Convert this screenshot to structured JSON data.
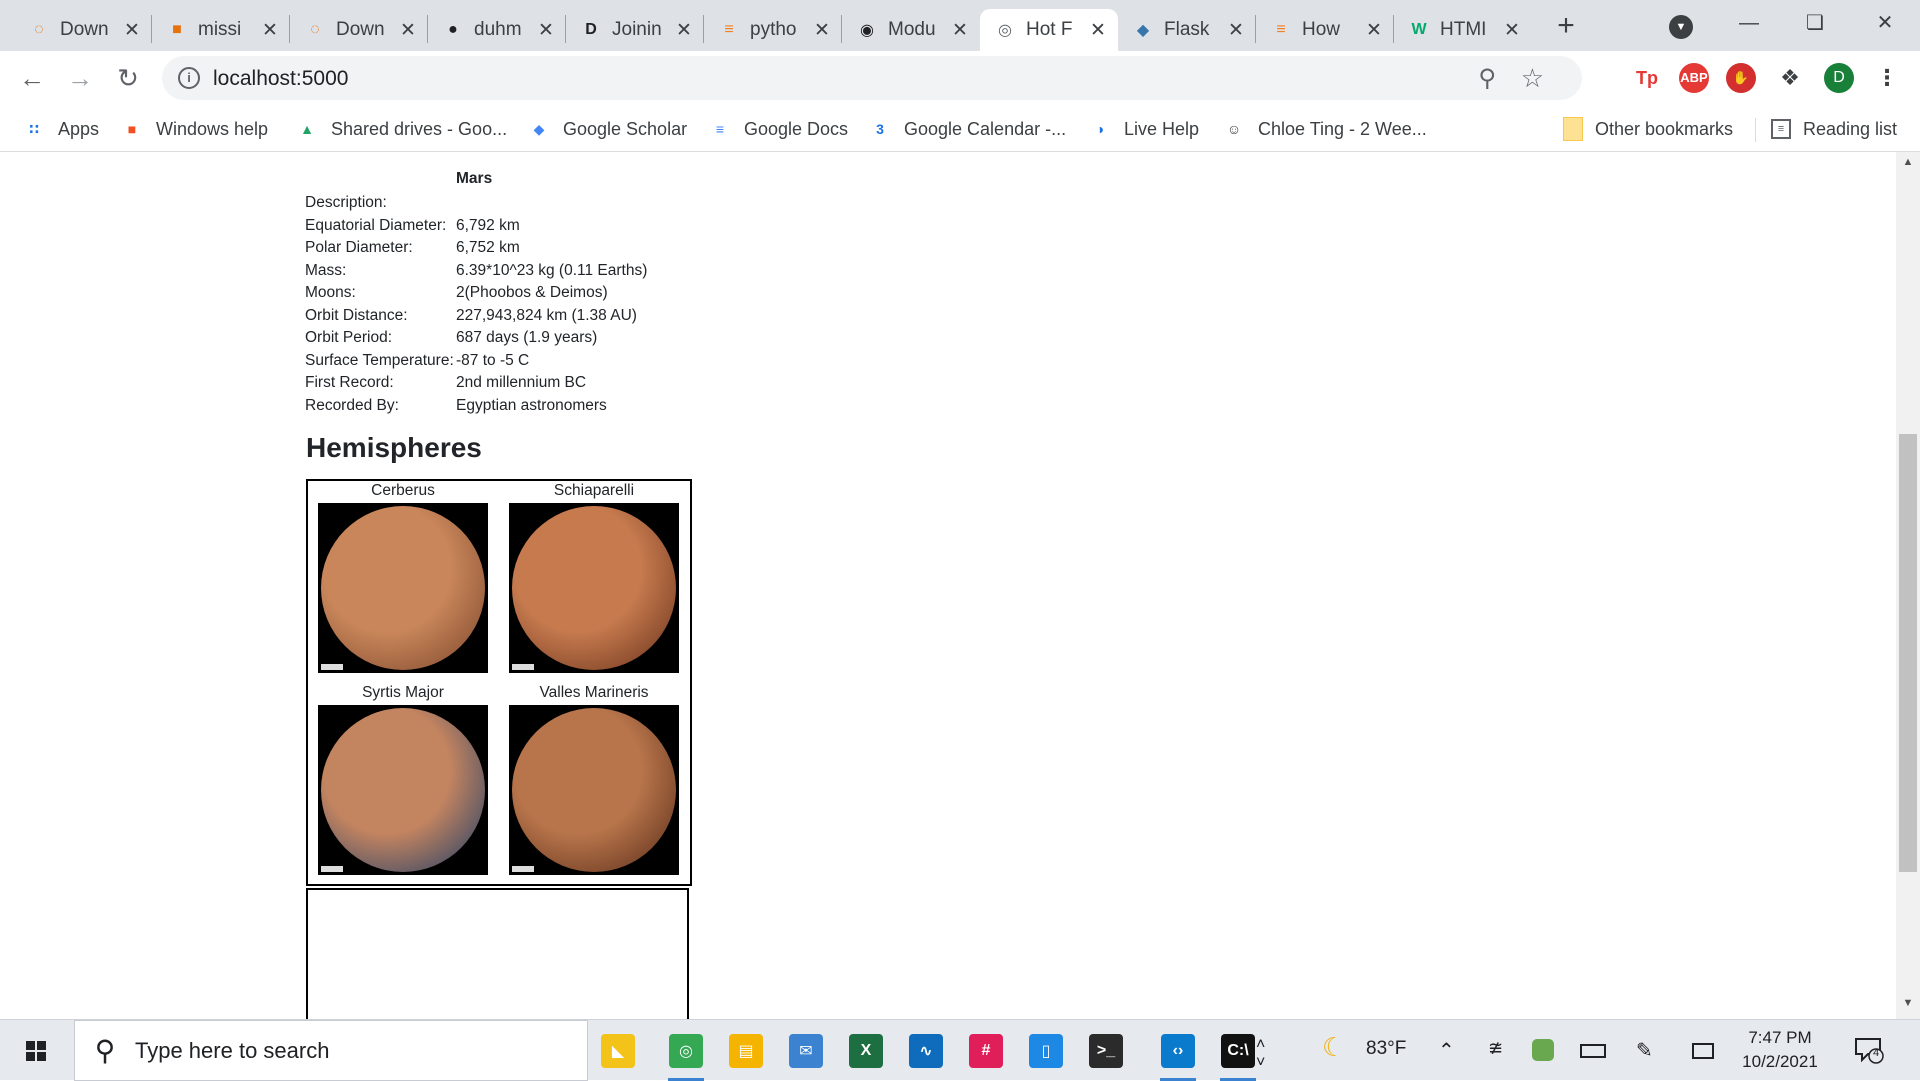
{
  "browser": {
    "tabs": [
      {
        "title": "Down",
        "favicon": "loading-spinner-icon",
        "color": "#e8710a",
        "active": false
      },
      {
        "title": "missi",
        "favicon": "book-icon",
        "color": "#e8710a",
        "active": false
      },
      {
        "title": "Down",
        "favicon": "loading-spinner-icon",
        "color": "#e8710a",
        "active": false
      },
      {
        "title": "duhm",
        "favicon": "github-icon",
        "color": "#202124",
        "active": false
      },
      {
        "title": "Joinin",
        "favicon": "d-logo-icon",
        "color": "#202124",
        "active": false
      },
      {
        "title": "pytho",
        "favicon": "stack-overflow-icon",
        "color": "#f48024",
        "active": false
      },
      {
        "title": "Modu",
        "favicon": "logo-icon",
        "color": "#202124",
        "active": false
      },
      {
        "title": "Hot F",
        "favicon": "globe-icon",
        "color": "#5f6368",
        "active": true
      },
      {
        "title": "Flask",
        "favicon": "python-icon",
        "color": "#3776ab",
        "active": false
      },
      {
        "title": "How",
        "favicon": "stack-overflow-icon",
        "color": "#f48024",
        "active": false
      },
      {
        "title": "HTMI",
        "favicon": "w3schools-icon",
        "color": "#04aa6d",
        "active": false
      }
    ],
    "url": "localhost:5000",
    "profile_initial": "D",
    "extensions": [
      {
        "label": "Tp",
        "name": "tp-extension-icon",
        "color": "#e53935"
      },
      {
        "label": "ABP",
        "name": "adblock-plus-icon",
        "color": "#e53935"
      },
      {
        "label": "✋",
        "name": "hand-stop-icon",
        "color": "#d32f2f"
      }
    ],
    "bookmarks": [
      {
        "label": "Apps",
        "icon": "apps-grid-icon"
      },
      {
        "label": "Windows help",
        "icon": "windows-logo-icon"
      },
      {
        "label": "Shared drives - Goo...",
        "icon": "google-drive-icon"
      },
      {
        "label": "Google Scholar",
        "icon": "google-scholar-icon"
      },
      {
        "label": "Google Docs",
        "icon": "google-docs-icon"
      },
      {
        "label": "Google Calendar -...",
        "icon": "google-calendar-icon"
      },
      {
        "label": "Live Help",
        "icon": "live-help-icon"
      },
      {
        "label": "Chloe Ting - 2 Wee...",
        "icon": "chloe-ting-icon"
      }
    ],
    "other_bookmarks": "Other bookmarks",
    "reading_list": "Reading list",
    "calendar_day": "3"
  },
  "page": {
    "facts_header": "Mars",
    "facts": [
      {
        "label": "Description:",
        "value": ""
      },
      {
        "label": "Equatorial Diameter:",
        "value": "6,792 km"
      },
      {
        "label": "Polar Diameter:",
        "value": "6,752 km"
      },
      {
        "label": "Mass:",
        "value": "6.39*10^23 kg (0.11 Earths)"
      },
      {
        "label": "Moons:",
        "value": "2(Phoobos & Deimos)"
      },
      {
        "label": "Orbit Distance:",
        "value": "227,943,824 km (1.38 AU)"
      },
      {
        "label": "Orbit Period:",
        "value": "687 days (1.9 years)"
      },
      {
        "label": "Surface Temperature:",
        "value": "-87 to -5 C"
      },
      {
        "label": "First Record:",
        "value": "2nd millennium BC"
      },
      {
        "label": "Recorded By:",
        "value": "Egyptian astronomers"
      }
    ],
    "hemispheres_title": "Hemispheres",
    "hemispheres": [
      {
        "name": "Cerberus",
        "base": "#c9865a",
        "dark": "#8a5234"
      },
      {
        "name": "Schiaparelli",
        "base": "#c67a4e",
        "dark": "#7a3f24"
      },
      {
        "name": "Syrtis Major",
        "base": "#c38460",
        "dark": "#3c4a66"
      },
      {
        "name": "Valles Marineris",
        "base": "#b8754b",
        "dark": "#6b3a22"
      }
    ]
  },
  "taskbar": {
    "search_placeholder": "Type here to search",
    "weather": "83°F",
    "time": "7:47 PM",
    "date": "10/2/2021",
    "notification_count": "4",
    "apps": [
      {
        "name": "sticky-notes-icon",
        "color": "#f3c319",
        "running": false
      },
      {
        "name": "chrome-icon",
        "color": "#34a853",
        "running": true
      },
      {
        "name": "file-explorer-icon",
        "color": "#f4b400",
        "running": false
      },
      {
        "name": "mail-icon",
        "color": "#3b83d1",
        "running": false
      },
      {
        "name": "excel-icon",
        "color": "#1d6f42",
        "running": false
      },
      {
        "name": "whiteboard-icon",
        "color": "#0f6cbd",
        "running": false
      },
      {
        "name": "slack-icon",
        "color": "#e01e5a",
        "running": false
      },
      {
        "name": "phone-link-icon",
        "color": "#1e88e5",
        "running": false
      },
      {
        "name": "terminal-icon",
        "color": "#2b2b2b",
        "running": false
      },
      {
        "name": "vscode-icon",
        "color": "#0a7acc",
        "running": true
      },
      {
        "name": "command-prompt-icon",
        "color": "#111111",
        "running": true
      }
    ]
  }
}
